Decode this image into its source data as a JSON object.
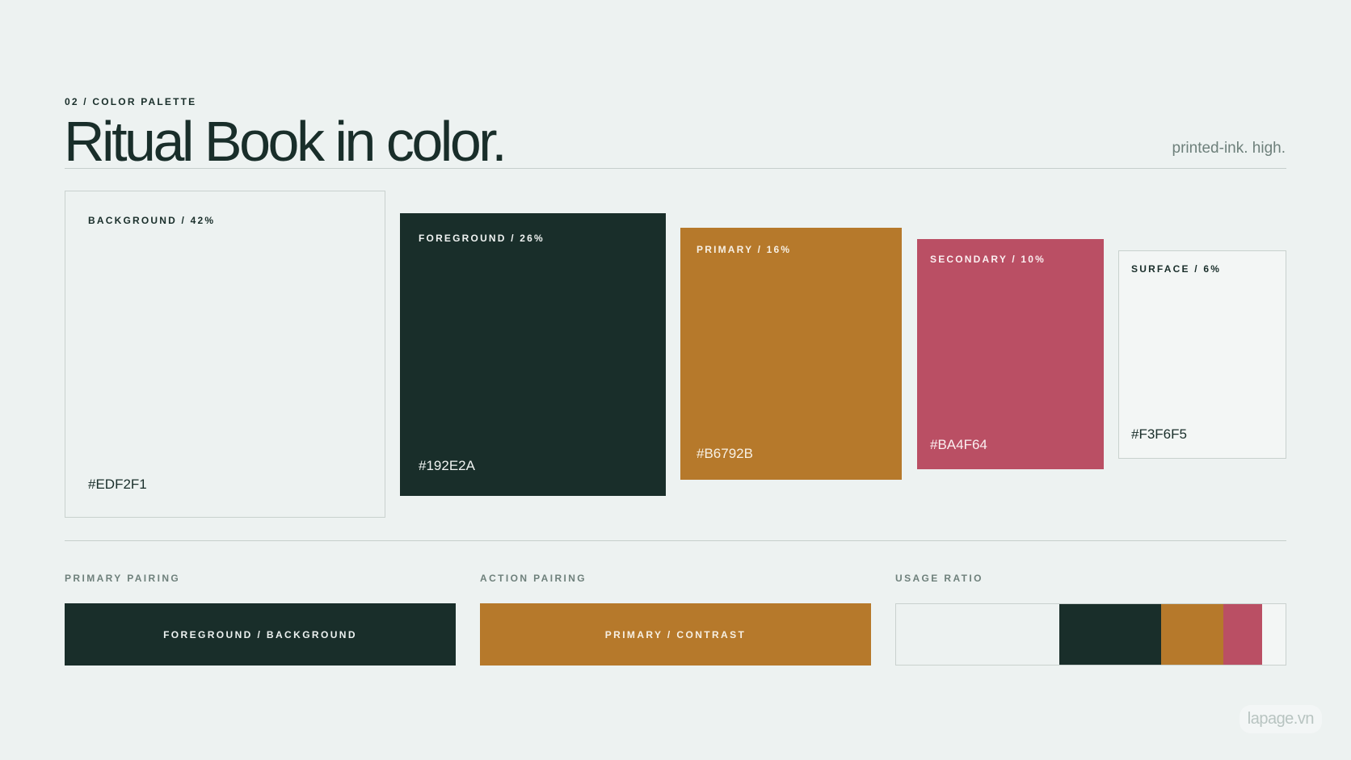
{
  "header": {
    "eyebrow": "02 / COLOR PALETTE",
    "title": "Ritual Book in color.",
    "tagline": "printed-ink. high."
  },
  "swatches": {
    "background": {
      "label": "BACKGROUND / 42%",
      "hex": "#EDF2F1",
      "color": "#EDF2F1",
      "share": 42
    },
    "foreground": {
      "label": "FOREGROUND / 26%",
      "hex": "#192E2A",
      "color": "#192E2A",
      "share": 26
    },
    "primary": {
      "label": "PRIMARY / 16%",
      "hex": "#B6792B",
      "color": "#B6792B",
      "share": 16
    },
    "secondary": {
      "label": "SECONDARY / 10%",
      "hex": "#BA4F64",
      "color": "#BA4F64",
      "share": 10
    },
    "surface": {
      "label": "SURFACE / 6%",
      "hex": "#F3F6F5",
      "color": "#F3F6F5",
      "share": 6
    }
  },
  "pairings": {
    "primary": {
      "heading": "PRIMARY PAIRING",
      "label": "FOREGROUND / BACKGROUND"
    },
    "action": {
      "heading": "ACTION PAIRING",
      "label": "PRIMARY / CONTRAST"
    }
  },
  "usage_ratio": {
    "heading": "USAGE RATIO",
    "segments": [
      {
        "color": "#EDF2F1",
        "percent": 42
      },
      {
        "color": "#192E2A",
        "percent": 26
      },
      {
        "color": "#B6792B",
        "percent": 16
      },
      {
        "color": "#BA4F64",
        "percent": 10
      },
      {
        "color": "#F3F6F5",
        "percent": 6
      }
    ]
  },
  "brand": {
    "text": "lapage.vn"
  }
}
